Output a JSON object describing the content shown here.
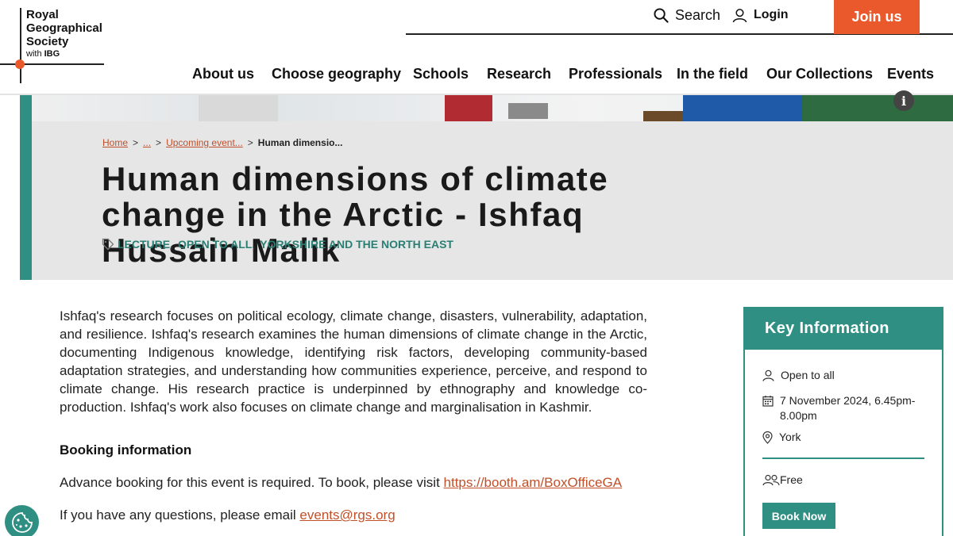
{
  "logo": {
    "line1": "Royal",
    "line2": "Geographical",
    "line3": "Society",
    "with": "with",
    "ibg": "IBG"
  },
  "utility": {
    "search_label": "Search",
    "login_label": "Login",
    "join_label": "Join us"
  },
  "nav": {
    "items": [
      "About us",
      "Choose geography",
      "Schools",
      "Research",
      "Professionals",
      "In the field",
      "Our Collections",
      "Events"
    ]
  },
  "hero": {
    "info_label": "i",
    "breadcrumb": {
      "home": "Home",
      "ellipsis": "...",
      "upcoming": "Upcoming event...",
      "current": "Human dimensio...",
      "separator": ">"
    },
    "title": "Human dimensions of climate change in the Arctic - Ishfaq Hussain Malik",
    "tags": [
      "LECTURE",
      "OPEN TO ALL",
      "YORKSHIRE AND THE NORTH EAST"
    ],
    "tag_separator": ","
  },
  "body": {
    "paragraph": "Ishfaq's research focuses on political ecology, climate change, disasters, vulnerability, adaptation, and resilience. Ishfaq's research examines the human dimensions of climate change in the Arctic, documenting Indigenous knowledge, identifying risk factors, developing community-based adaptation strategies, and understanding how communities experience, perceive, and respond to climate change. His research practice is underpinned by ethnography and knowledge co-production. Ishfaq's work also focuses on climate change and marginalisation in Kashmir.",
    "booking_heading": "Booking information",
    "booking_text": "Advance booking for this event is required. To book, please visit ",
    "booking_link": "https://booth.am/BoxOfficeGA",
    "email_text": "If you have any questions, please email ",
    "email_link": "events@rgs.org"
  },
  "key_info": {
    "heading": "Key Information",
    "audience": "Open to all",
    "date": "7 November 2024, 6.45pm-8.00pm",
    "location": "York",
    "price": "Free",
    "book_label": "Book Now"
  },
  "colors": {
    "brand_orange": "#e9592b",
    "teal": "#2f8f83",
    "link": "#c1502a",
    "panel_grey": "#e6e6e6"
  },
  "icons": {
    "search": "search-icon",
    "login": "user-icon",
    "tag": "tag-icon",
    "audience": "person-icon",
    "date": "calendar-icon",
    "location": "map-pin-icon",
    "price": "group-icon",
    "cookie": "cookie-icon",
    "info": "info-icon"
  }
}
